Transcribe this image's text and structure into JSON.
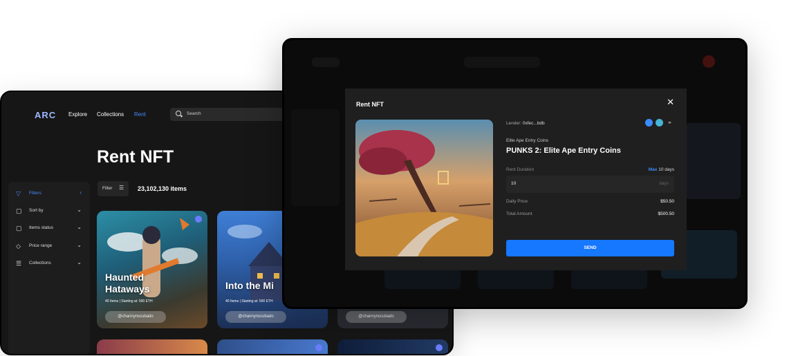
{
  "back_window": {
    "logo": "ARC",
    "nav": [
      "Explore",
      "Collections",
      "Rent"
    ],
    "search_placeholder": "Search",
    "page_title": "Rent NFT",
    "filter_label": "Filter",
    "items_count": "23,102,130 items",
    "sidebar": [
      {
        "label": "Filters",
        "icon": "filter-icon",
        "active": true
      },
      {
        "label": "Sort by",
        "icon": "bag-icon"
      },
      {
        "label": "Items status",
        "icon": "bag-icon"
      },
      {
        "label": "Price range",
        "icon": "tag-icon"
      },
      {
        "label": "Collections",
        "icon": "list-icon"
      }
    ],
    "cards": [
      {
        "name": "Haunted\nHataways",
        "items": "40 Items",
        "starting": "Starting at: 500 ETH",
        "owner": "@channynscubado"
      },
      {
        "name": "Into the Mi",
        "items": "40 Items",
        "starting": "Starting at: 500 ETH",
        "owner": "@channynscubado"
      },
      {
        "owner": "@channynscubado"
      }
    ]
  },
  "modal": {
    "title": "Rent NFT",
    "lender_label": "Lender:",
    "lender_address": "0xfec...bdb",
    "collection_name": "Elite Ape Entry Coins",
    "nft_title": "PUNKS 2: Elite Ape Entry Coins",
    "rent_duration_label": "Rent Duration",
    "max_label": "Max",
    "max_value": "10 days",
    "duration_value": "10",
    "duration_unit": "days",
    "daily_price_label": "Daily Price",
    "daily_price_value": "$50.50",
    "total_amount_label": "Total Amount",
    "total_amount_value": "$500.50",
    "send_label": "SEND"
  },
  "colors": {
    "accent": "#1677ff",
    "link": "#4a8cff"
  }
}
